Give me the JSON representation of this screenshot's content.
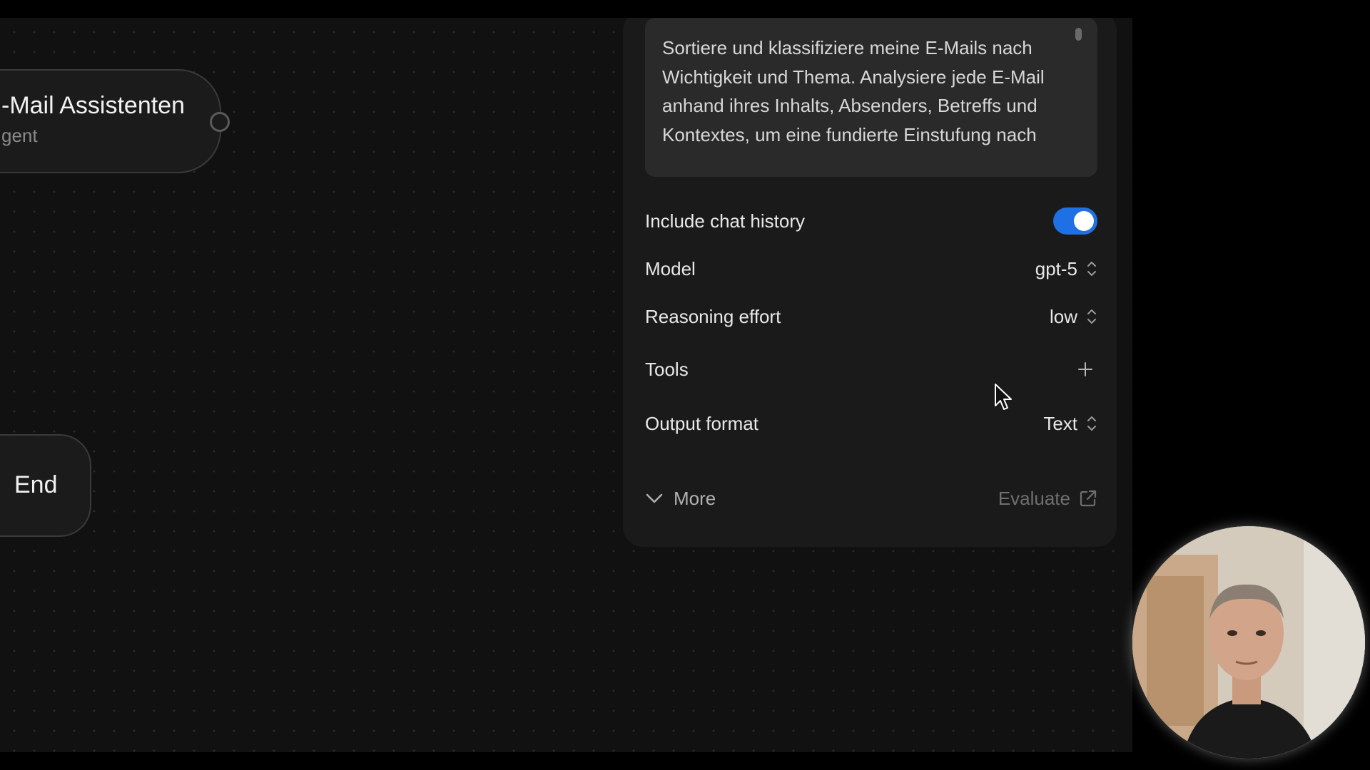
{
  "canvas": {
    "agent_node": {
      "title": "-Mail Assistenten",
      "subtitle": "gent"
    },
    "end_node": {
      "title": "End"
    }
  },
  "panel": {
    "instructions": "Sortiere und klassifiziere meine E-Mails nach Wichtigkeit und Thema. Analysiere jede E-Mail anhand ihres Inhalts, Absenders, Betreffs und Kontextes, um eine fundierte Einstufung nach",
    "include_chat_history": {
      "label": "Include chat history",
      "enabled": true
    },
    "model": {
      "label": "Model",
      "value": "gpt-5"
    },
    "reasoning_effort": {
      "label": "Reasoning effort",
      "value": "low"
    },
    "tools": {
      "label": "Tools"
    },
    "output_format": {
      "label": "Output format",
      "value": "Text"
    },
    "more_label": "More",
    "evaluate_label": "Evaluate"
  },
  "colors": {
    "accent": "#1f6fe5",
    "canvas_bg": "#111111",
    "panel_bg": "#1a1a1a"
  }
}
